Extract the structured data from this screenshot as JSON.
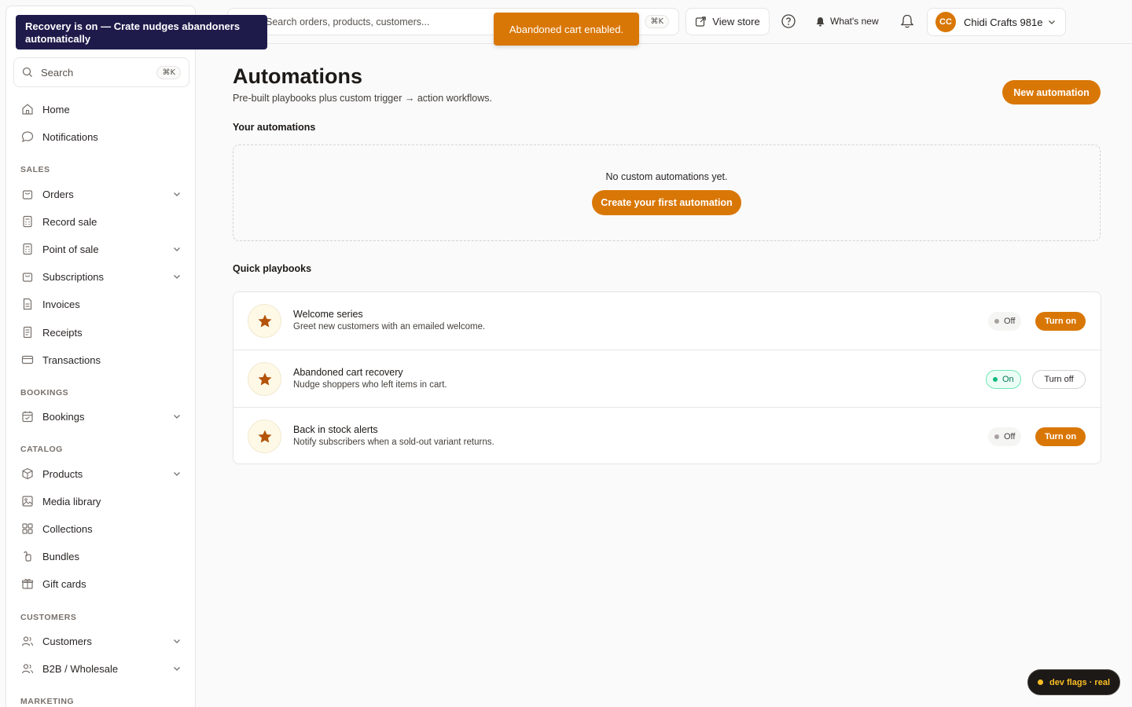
{
  "tooltip": {
    "text": "Recovery is on — Crate nudges abandoners automatically"
  },
  "toast": {
    "text": "Abandoned cart enabled."
  },
  "sidebar": {
    "search": {
      "placeholder": "Search",
      "shortcut": "⌘K"
    },
    "items": {
      "home": "Home",
      "notifications": "Notifications",
      "orders": "Orders",
      "record_sale": "Record sale",
      "point_of_sale": "Point of sale",
      "subscriptions": "Subscriptions",
      "invoices": "Invoices",
      "receipts": "Receipts",
      "transactions": "Transactions",
      "bookings": "Bookings",
      "products": "Products",
      "media_library": "Media library",
      "collections": "Collections",
      "bundles": "Bundles",
      "gift_cards": "Gift cards",
      "customers": "Customers",
      "b2b": "B2B / Wholesale"
    },
    "sections": {
      "sales": "SALES",
      "bookings": "BOOKINGS",
      "catalog": "CATALOG",
      "customers": "CUSTOMERS",
      "marketing": "MARKETING"
    }
  },
  "topbar": {
    "search_placeholder": "Search orders, products, customers...",
    "search_shortcut": "⌘K",
    "view_store": "View store",
    "whats_new": "What's new",
    "account": {
      "initials": "CC",
      "name": "Chidi Crafts 981e"
    }
  },
  "page": {
    "title": "Automations",
    "subtitle": "Pre-built playbooks plus custom trigger → action workflows.",
    "new_automation": "New automation",
    "your_automations_heading": "Your automations",
    "empty_text": "No custom automations yet.",
    "create_first": "Create your first automation",
    "quick_playbooks_heading": "Quick playbooks"
  },
  "playbooks": [
    {
      "title": "Welcome series",
      "description": "Greet new customers with an emailed welcome.",
      "status": "Off",
      "action": "Turn on"
    },
    {
      "title": "Abandoned cart recovery",
      "description": "Nudge shoppers who left items in cart.",
      "status": "On",
      "action": "Turn off"
    },
    {
      "title": "Back in stock alerts",
      "description": "Notify subscribers when a sold-out variant returns.",
      "status": "Off",
      "action": "Turn on"
    }
  ],
  "dev_flags": {
    "label": "dev flags · real"
  },
  "colors": {
    "accent": "#d97706",
    "tooltip_bg": "#1e1b4b",
    "on_green": "#10b981"
  }
}
